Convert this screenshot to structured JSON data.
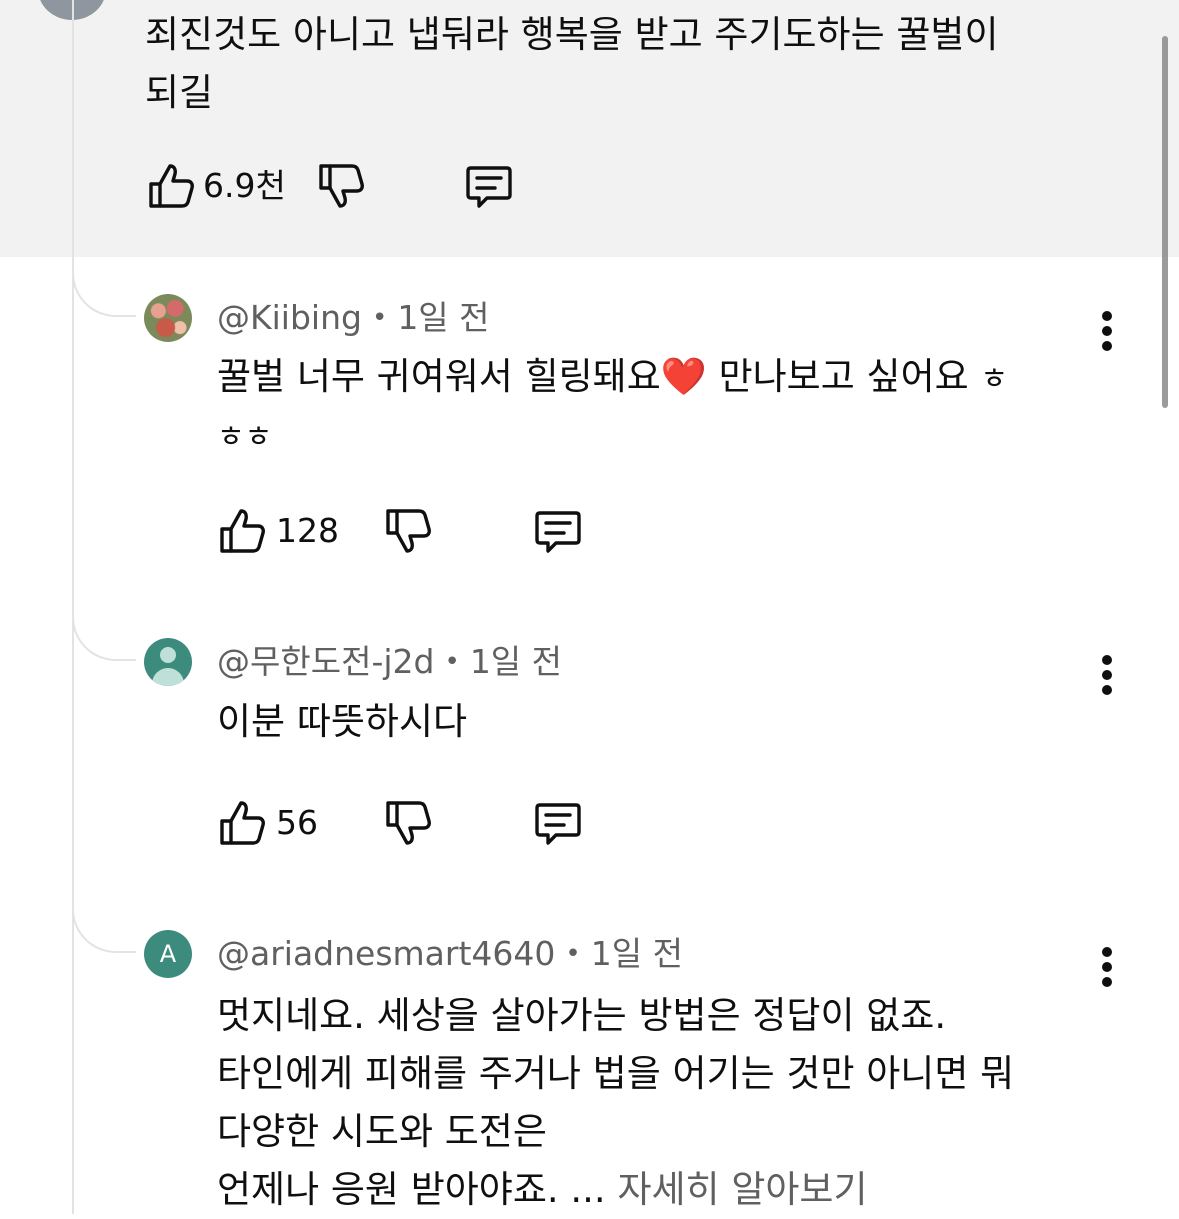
{
  "parent_comment": {
    "text_lines": [
      "죄진것도 아니고 냅둬라 행복을 받고 주기도하는 꿀벌이",
      "되길"
    ],
    "likes": "6.9천"
  },
  "replies": [
    {
      "handle": "@Kiibing",
      "time": "1일 전",
      "avatar": "flowers-photo",
      "text_line1": "꿀벌 너무 귀여워서 힐링돼요",
      "heart": "❤️",
      "text_line1_rest": " 만나보고 싶어요 ",
      "text_line1_end": "ㅎ",
      "text_line2": "ㅎㅎ",
      "likes": "128"
    },
    {
      "handle": "@무한도전-j2d",
      "time": "1일 전",
      "avatar": "default-person-icon",
      "text_line1": "이분 따뜻하시다",
      "likes": "56"
    },
    {
      "handle": "@ariadnesmart4640",
      "time": "1일 전",
      "avatar_letter": "A",
      "text_lines": [
        "멋지네요. 세상을 살아가는 방법은 정답이 없죠.",
        "타인에게 피해를 주거나 법을 어기는 것만 아니면 뭐",
        "다양한 시도와 도전은"
      ],
      "text_last": "언제나 응원 받아야죠. ... ",
      "more_label": "자세히 알아보기"
    }
  ],
  "icons": {
    "like": "thumbs-up-icon",
    "dislike": "thumbs-down-icon",
    "reply": "comment-reply-icon",
    "more": "more-vert-icon"
  },
  "separator_dot": "•",
  "colors": {
    "panel_bg": "#f2f2f2",
    "text": "#0f0f0f",
    "secondary_text": "#606060",
    "avatar_teal": "#3d8b7c"
  }
}
